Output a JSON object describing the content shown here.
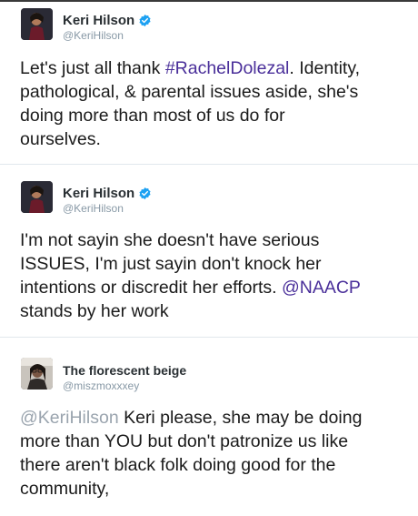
{
  "tweets": [
    {
      "display_name": "Keri Hilson",
      "handle": "@KeriHilson",
      "verified": true,
      "parts": [
        {
          "text": "Let's just all thank "
        },
        {
          "text": "#RachelDolezal",
          "kind": "hashtag"
        },
        {
          "text": ". Identity,\npathological, & parental issues aside, she's\ndoing more than most of us do for\nourselves."
        }
      ]
    },
    {
      "display_name": "Keri Hilson",
      "handle": "@KeriHilson",
      "verified": true,
      "parts": [
        {
          "text": "I'm not sayin she doesn't have serious\nISSUES, I'm just sayin don't knock her\nintentions or discredit her efforts. "
        },
        {
          "text": "@NAACP",
          "kind": "mention"
        },
        {
          "text": "\nstands by her work"
        }
      ]
    },
    {
      "display_name": "The florescent beige",
      "handle": "@miszmoxxxey",
      "verified": false,
      "parts": [
        {
          "text": "@KeriHilson",
          "kind": "mention-grey"
        },
        {
          "text": " Keri please, she may be doing\nmore than YOU but don't patronize us like\nthere aren't black folk doing good for the\ncommunity,"
        }
      ]
    }
  ],
  "colors": {
    "hashtag": "#4a2f9a",
    "mention": "#4a2f9a",
    "mention_grey": "#9aa4ae",
    "verified_badge": "#1da1f2",
    "handle": "#8899a6"
  },
  "icons": [
    "verified-badge-icon"
  ]
}
